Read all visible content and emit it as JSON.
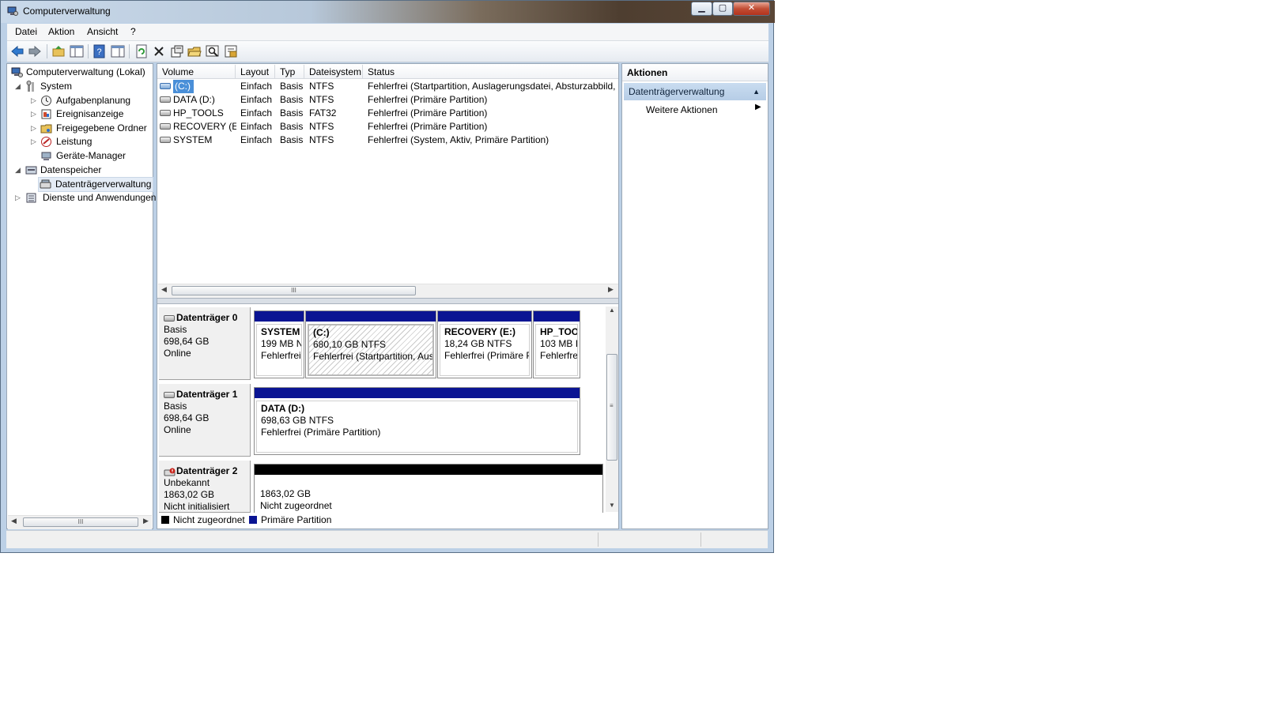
{
  "window": {
    "title": "Computerverwaltung"
  },
  "menu": [
    "Datei",
    "Aktion",
    "Ansicht",
    "?"
  ],
  "toolbar_icons": [
    "back-arrow-icon",
    "forward-arrow-icon",
    "up-folder-icon",
    "show-hide-tree-icon",
    "help-icon",
    "show-hide-action-pane-icon",
    "refresh-icon",
    "delete-icon",
    "properties-icon",
    "open-icon",
    "search-icon",
    "export-icon"
  ],
  "tree": {
    "root": "Computerverwaltung (Lokal)",
    "system": "System",
    "aufgabenplanung": "Aufgabenplanung",
    "ereignisanzeige": "Ereignisanzeige",
    "freigegebene_ordner": "Freigegebene Ordner",
    "leistung": "Leistung",
    "geraete_manager": "Geräte-Manager",
    "datenspeicher": "Datenspeicher",
    "datentraegerverwaltung": "Datenträgerverwaltung",
    "dienste": "Dienste und Anwendungen"
  },
  "volume_list": {
    "columns": [
      "Volume",
      "Layout",
      "Typ",
      "Dateisystem",
      "Status"
    ],
    "rows": [
      [
        "(C:)",
        "Einfach",
        "Basis",
        "NTFS",
        "Fehlerfrei (Startpartition, Auslagerungsdatei, Absturzabbild, P"
      ],
      [
        "DATA (D:)",
        "Einfach",
        "Basis",
        "NTFS",
        "Fehlerfrei (Primäre Partition)"
      ],
      [
        "HP_TOOLS",
        "Einfach",
        "Basis",
        "FAT32",
        "Fehlerfrei (Primäre Partition)"
      ],
      [
        "RECOVERY (E:)",
        "Einfach",
        "Basis",
        "NTFS",
        "Fehlerfrei (Primäre Partition)"
      ],
      [
        "SYSTEM",
        "Einfach",
        "Basis",
        "NTFS",
        "Fehlerfrei (System, Aktiv, Primäre Partition)"
      ]
    ]
  },
  "disks": [
    {
      "name": "Datenträger 0",
      "type": "Basis",
      "size": "698,64 GB",
      "state": "Online",
      "partitions": [
        {
          "label": "SYSTEM",
          "size": "199 MB N",
          "status": "Fehlerfrei"
        },
        {
          "label": "(C:)",
          "size": "680,10 GB NTFS",
          "status": "Fehlerfrei (Startpartition, Ausl"
        },
        {
          "label": "RECOVERY  (E:)",
          "size": "18,24 GB NTFS",
          "status": "Fehlerfrei (Primäre P"
        },
        {
          "label": "HP_TOO",
          "size": "103 MB I",
          "status": "Fehlerfre"
        }
      ]
    },
    {
      "name": "Datenträger 1",
      "type": "Basis",
      "size": "698,64 GB",
      "state": "Online",
      "partitions": [
        {
          "label": "DATA  (D:)",
          "size": "698,63 GB NTFS",
          "status": "Fehlerfrei (Primäre Partition)"
        }
      ]
    },
    {
      "name": "Datenträger 2",
      "type": "Unbekannt",
      "size": "1863,02 GB",
      "state": "Nicht initialisiert",
      "partitions": [
        {
          "size": "1863,02 GB",
          "status": "Nicht zugeordnet"
        }
      ]
    }
  ],
  "legend": {
    "unallocated": "Nicht zugeordnet",
    "primary": "Primäre Partition"
  },
  "actions": {
    "header": "Aktionen",
    "group": "Datenträgerverwaltung",
    "item": "Weitere Aktionen"
  },
  "colors": {
    "primary_partition": "#0a1493",
    "unallocated": "#000000",
    "selection": "#4a8fd8"
  }
}
